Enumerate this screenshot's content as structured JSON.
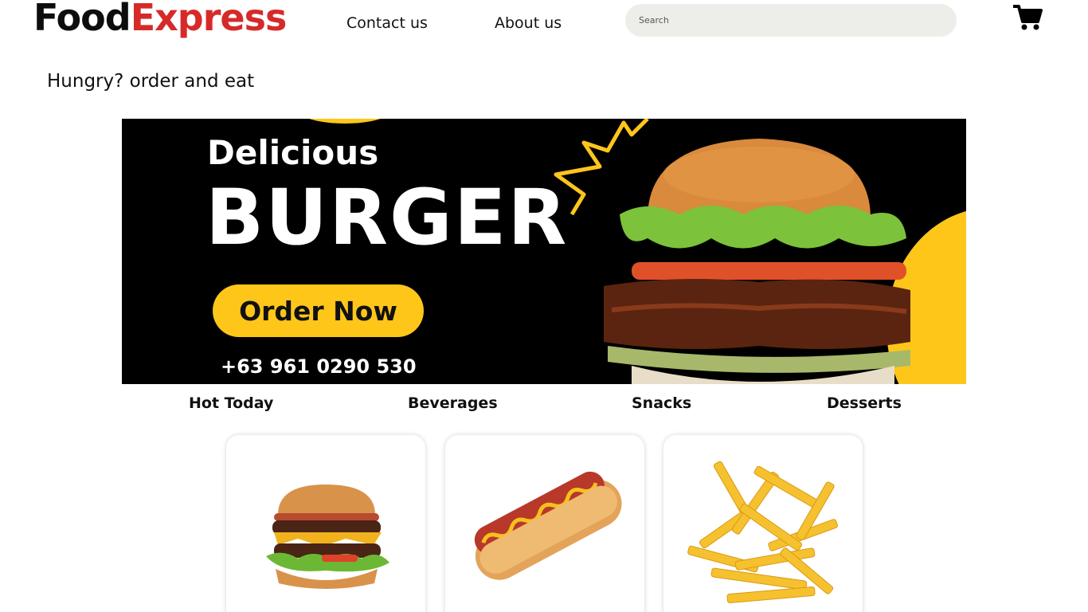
{
  "header": {
    "logo_part1": "Food",
    "logo_part2": "Express",
    "nav": [
      "Contact us",
      "About us"
    ],
    "search_placeholder": "Search",
    "cart_icon": "cart-icon"
  },
  "tagline": "Hungry? order and eat",
  "banner": {
    "line1": "Delicious",
    "line2": "BURGER",
    "cta": "Order Now",
    "phone": "+63 961 0290 530"
  },
  "categories": [
    "Hot Today",
    "Beverages",
    "Snacks",
    "Desserts"
  ],
  "products": [
    {
      "image": "burger-image"
    },
    {
      "image": "hotdog-image"
    },
    {
      "image": "fries-image"
    }
  ],
  "colors": {
    "brand_red": "#d62a2a",
    "accent_yellow": "#ffc61a",
    "banner_bg": "#000000",
    "search_bg": "#ededea"
  }
}
